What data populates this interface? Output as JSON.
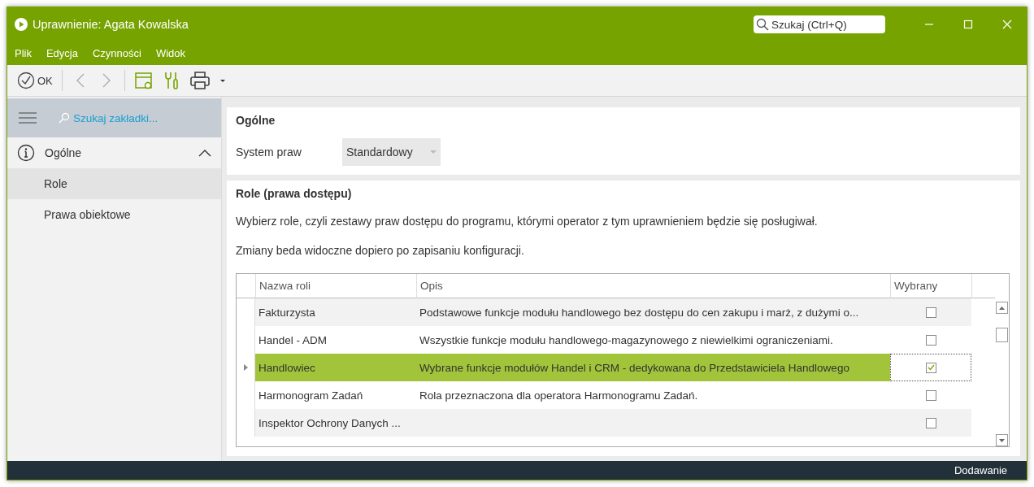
{
  "window": {
    "title": "Uprawnienie: Agata Kowalska",
    "search_placeholder": "Szukaj (Ctrl+Q)"
  },
  "menu": [
    "Plik",
    "Edycja",
    "Czynności",
    "Widok"
  ],
  "toolbar": {
    "ok_label": "OK"
  },
  "sidebar": {
    "search_placeholder": "Szukaj zakładki...",
    "section": {
      "label": "Ogólne",
      "expanded": true
    },
    "items": [
      {
        "label": "Role",
        "selected": true
      },
      {
        "label": "Prawa obiektowe",
        "selected": false
      }
    ]
  },
  "general": {
    "title": "Ogólne",
    "field_label": "System praw",
    "field_value": "Standardowy"
  },
  "roles": {
    "title": "Role (prawa dostępu)",
    "description": "Wybierz role, czyli zestawy praw dostępu do programu, którymi operator z tym uprawnieniem będzie się posługiwał.",
    "note": "Zmiany beda widoczne dopiero po zapisaniu konfiguracji.",
    "table": {
      "columns": [
        "Nazwa roli",
        "Opis",
        "Wybrany"
      ],
      "rows": [
        {
          "name": "Fakturzysta",
          "description": "Podstawowe funkcje modułu handlowego bez dostępu do cen zakupu i marż, z dużymi o...",
          "checked": false,
          "selected": false
        },
        {
          "name": "Handel - ADM",
          "description": "Wszystkie funkcje modułu handlowego-magazynowego z niewielkimi ograniczeniami.",
          "checked": false,
          "selected": false
        },
        {
          "name": "Handlowiec",
          "description": "Wybrane funkcje modułów Handel i CRM - dedykowana do Przedstawiciela Handlowego",
          "checked": true,
          "selected": true
        },
        {
          "name": "Harmonogram Zadań",
          "description": "Rola przeznaczona dla operatora Harmonogramu Zadań.",
          "checked": false,
          "selected": false
        },
        {
          "name": "Inspektor Ochrony Danych ...",
          "checked": false,
          "selected": false
        }
      ]
    }
  },
  "status_bar": "Dodawanie"
}
